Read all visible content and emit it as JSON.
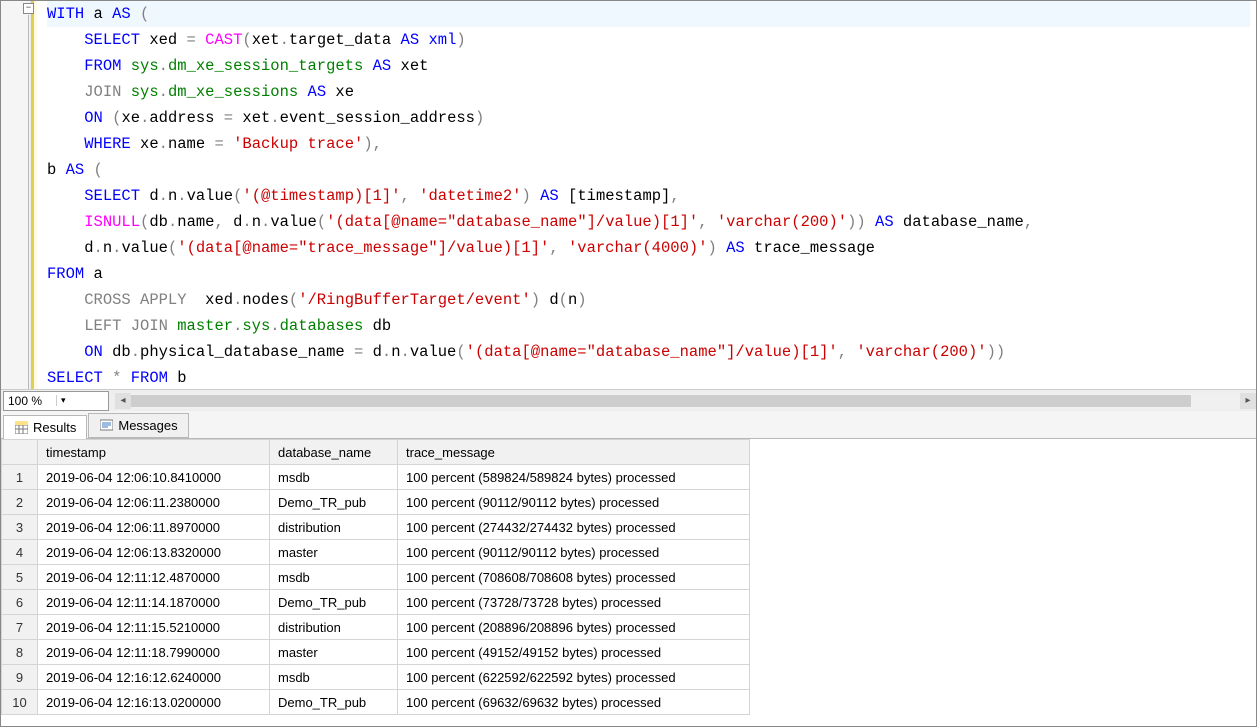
{
  "editor": {
    "zoom": "100 %",
    "foldGlyph": "−"
  },
  "code": {
    "tokens": [
      [
        [
          "kw-blue",
          "WITH"
        ],
        [
          "txt",
          " a "
        ],
        [
          "kw-blue",
          "AS"
        ],
        [
          "kw-gray",
          " ("
        ]
      ],
      [
        [
          "txt",
          "    "
        ],
        [
          "kw-blue",
          "SELECT"
        ],
        [
          "txt",
          " xed "
        ],
        [
          "kw-gray",
          "="
        ],
        [
          "txt",
          " "
        ],
        [
          "kw-magenta",
          "CAST"
        ],
        [
          "kw-gray",
          "("
        ],
        [
          "txt",
          "xet"
        ],
        [
          "kw-gray",
          "."
        ],
        [
          "txt",
          "target_data "
        ],
        [
          "kw-blue",
          "AS"
        ],
        [
          "txt",
          " "
        ],
        [
          "kw-blue",
          "xml"
        ],
        [
          "kw-gray",
          ")"
        ]
      ],
      [
        [
          "txt",
          "    "
        ],
        [
          "kw-blue",
          "FROM"
        ],
        [
          "txt",
          " "
        ],
        [
          "kw-green",
          "sys"
        ],
        [
          "kw-gray",
          "."
        ],
        [
          "kw-green",
          "dm_xe_session_targets"
        ],
        [
          "txt",
          " "
        ],
        [
          "kw-blue",
          "AS"
        ],
        [
          "txt",
          " xet"
        ]
      ],
      [
        [
          "txt",
          "    "
        ],
        [
          "kw-gray",
          "JOIN"
        ],
        [
          "txt",
          " "
        ],
        [
          "kw-green",
          "sys"
        ],
        [
          "kw-gray",
          "."
        ],
        [
          "kw-green",
          "dm_xe_sessions"
        ],
        [
          "txt",
          " "
        ],
        [
          "kw-blue",
          "AS"
        ],
        [
          "txt",
          " xe"
        ]
      ],
      [
        [
          "txt",
          "    "
        ],
        [
          "kw-blue",
          "ON"
        ],
        [
          "txt",
          " "
        ],
        [
          "kw-gray",
          "("
        ],
        [
          "txt",
          "xe"
        ],
        [
          "kw-gray",
          "."
        ],
        [
          "txt",
          "address "
        ],
        [
          "kw-gray",
          "="
        ],
        [
          "txt",
          " xet"
        ],
        [
          "kw-gray",
          "."
        ],
        [
          "txt",
          "event_session_address"
        ],
        [
          "kw-gray",
          ")"
        ]
      ],
      [
        [
          "txt",
          "    "
        ],
        [
          "kw-blue",
          "WHERE"
        ],
        [
          "txt",
          " xe"
        ],
        [
          "kw-gray",
          "."
        ],
        [
          "txt",
          "name "
        ],
        [
          "kw-gray",
          "="
        ],
        [
          "txt",
          " "
        ],
        [
          "kw-red",
          "'Backup trace'"
        ],
        [
          "kw-gray",
          "),"
        ]
      ],
      [
        [
          "txt",
          "b "
        ],
        [
          "kw-blue",
          "AS"
        ],
        [
          "kw-gray",
          " ("
        ]
      ],
      [
        [
          "txt",
          "    "
        ],
        [
          "kw-blue",
          "SELECT"
        ],
        [
          "txt",
          " d"
        ],
        [
          "kw-gray",
          "."
        ],
        [
          "txt",
          "n"
        ],
        [
          "kw-gray",
          "."
        ],
        [
          "txt",
          "value"
        ],
        [
          "kw-gray",
          "("
        ],
        [
          "kw-red",
          "'(@timestamp)[1]'"
        ],
        [
          "kw-gray",
          ","
        ],
        [
          "txt",
          " "
        ],
        [
          "kw-red",
          "'datetime2'"
        ],
        [
          "kw-gray",
          ")"
        ],
        [
          "txt",
          " "
        ],
        [
          "kw-blue",
          "AS"
        ],
        [
          "txt",
          " [timestamp]"
        ],
        [
          "kw-gray",
          ","
        ]
      ],
      [
        [
          "txt",
          "    "
        ],
        [
          "kw-magenta",
          "ISNULL"
        ],
        [
          "kw-gray",
          "("
        ],
        [
          "txt",
          "db"
        ],
        [
          "kw-gray",
          "."
        ],
        [
          "txt",
          "name"
        ],
        [
          "kw-gray",
          ","
        ],
        [
          "txt",
          " d"
        ],
        [
          "kw-gray",
          "."
        ],
        [
          "txt",
          "n"
        ],
        [
          "kw-gray",
          "."
        ],
        [
          "txt",
          "value"
        ],
        [
          "kw-gray",
          "("
        ],
        [
          "kw-red",
          "'(data[@name=\"database_name\"]/value)[1]'"
        ],
        [
          "kw-gray",
          ","
        ],
        [
          "txt",
          " "
        ],
        [
          "kw-red",
          "'varchar(200)'"
        ],
        [
          "kw-gray",
          "))"
        ],
        [
          "txt",
          " "
        ],
        [
          "kw-blue",
          "AS"
        ],
        [
          "txt",
          " database_name"
        ],
        [
          "kw-gray",
          ","
        ]
      ],
      [
        [
          "txt",
          "    d"
        ],
        [
          "kw-gray",
          "."
        ],
        [
          "txt",
          "n"
        ],
        [
          "kw-gray",
          "."
        ],
        [
          "txt",
          "value"
        ],
        [
          "kw-gray",
          "("
        ],
        [
          "kw-red",
          "'(data[@name=\"trace_message\"]/value)[1]'"
        ],
        [
          "kw-gray",
          ","
        ],
        [
          "txt",
          " "
        ],
        [
          "kw-red",
          "'varchar(4000)'"
        ],
        [
          "kw-gray",
          ")"
        ],
        [
          "txt",
          " "
        ],
        [
          "kw-blue",
          "AS"
        ],
        [
          "txt",
          " trace_message"
        ]
      ],
      [
        [
          "kw-blue",
          "FROM"
        ],
        [
          "txt",
          " a"
        ]
      ],
      [
        [
          "txt",
          "    "
        ],
        [
          "kw-gray",
          "CROSS APPLY"
        ],
        [
          "txt",
          "  xed"
        ],
        [
          "kw-gray",
          "."
        ],
        [
          "txt",
          "nodes"
        ],
        [
          "kw-gray",
          "("
        ],
        [
          "kw-red",
          "'/RingBufferTarget/event'"
        ],
        [
          "kw-gray",
          ")"
        ],
        [
          "txt",
          " d"
        ],
        [
          "kw-gray",
          "("
        ],
        [
          "txt",
          "n"
        ],
        [
          "kw-gray",
          ")"
        ]
      ],
      [
        [
          "txt",
          "    "
        ],
        [
          "kw-gray",
          "LEFT JOIN"
        ],
        [
          "txt",
          " "
        ],
        [
          "kw-green",
          "master"
        ],
        [
          "kw-gray",
          "."
        ],
        [
          "kw-green",
          "sys"
        ],
        [
          "kw-gray",
          "."
        ],
        [
          "kw-green",
          "databases"
        ],
        [
          "txt",
          " db"
        ]
      ],
      [
        [
          "txt",
          "    "
        ],
        [
          "kw-blue",
          "ON"
        ],
        [
          "txt",
          " db"
        ],
        [
          "kw-gray",
          "."
        ],
        [
          "txt",
          "physical_database_name "
        ],
        [
          "kw-gray",
          "="
        ],
        [
          "txt",
          " d"
        ],
        [
          "kw-gray",
          "."
        ],
        [
          "txt",
          "n"
        ],
        [
          "kw-gray",
          "."
        ],
        [
          "txt",
          "value"
        ],
        [
          "kw-gray",
          "("
        ],
        [
          "kw-red",
          "'(data[@name=\"database_name\"]/value)[1]'"
        ],
        [
          "kw-gray",
          ","
        ],
        [
          "txt",
          " "
        ],
        [
          "kw-red",
          "'varchar(200)'"
        ],
        [
          "kw-gray",
          "))"
        ]
      ],
      [
        [
          "kw-blue",
          "SELECT"
        ],
        [
          "txt",
          " "
        ],
        [
          "kw-gray",
          "*"
        ],
        [
          "txt",
          " "
        ],
        [
          "kw-blue",
          "FROM"
        ],
        [
          "txt",
          " b"
        ]
      ]
    ]
  },
  "tabs": {
    "results": "Results",
    "messages": "Messages"
  },
  "results": {
    "columns": [
      "timestamp",
      "database_name",
      "trace_message"
    ],
    "rows": [
      [
        "2019-06-04 12:06:10.8410000",
        "msdb",
        "100 percent (589824/589824 bytes) processed"
      ],
      [
        "2019-06-04 12:06:11.2380000",
        "Demo_TR_pub",
        "100 percent (90112/90112 bytes) processed"
      ],
      [
        "2019-06-04 12:06:11.8970000",
        "distribution",
        "100 percent (274432/274432 bytes) processed"
      ],
      [
        "2019-06-04 12:06:13.8320000",
        "master",
        "100 percent (90112/90112 bytes) processed"
      ],
      [
        "2019-06-04 12:11:12.4870000",
        "msdb",
        "100 percent (708608/708608 bytes) processed"
      ],
      [
        "2019-06-04 12:11:14.1870000",
        "Demo_TR_pub",
        "100 percent (73728/73728 bytes) processed"
      ],
      [
        "2019-06-04 12:11:15.5210000",
        "distribution",
        "100 percent (208896/208896 bytes) processed"
      ],
      [
        "2019-06-04 12:11:18.7990000",
        "master",
        "100 percent (49152/49152 bytes) processed"
      ],
      [
        "2019-06-04 12:16:12.6240000",
        "msdb",
        "100 percent (622592/622592 bytes) processed"
      ],
      [
        "2019-06-04 12:16:13.0200000",
        "Demo_TR_pub",
        "100 percent (69632/69632 bytes) processed"
      ]
    ]
  }
}
